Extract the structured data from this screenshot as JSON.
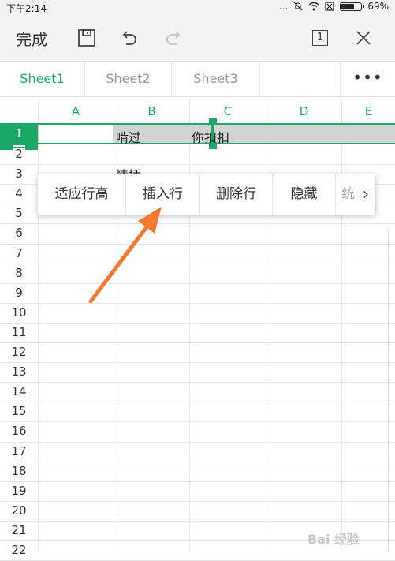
{
  "status": {
    "time": "下午2:14",
    "dots": "...",
    "battery": "69%",
    "battery_level": 0.69
  },
  "toolbar": {
    "done_label": "完成",
    "page_count": "1"
  },
  "tabs": [
    {
      "label": "Sheet1",
      "active": true
    },
    {
      "label": "Sheet2",
      "active": false
    },
    {
      "label": "Sheet3",
      "active": false
    }
  ],
  "more_label": "•••",
  "columns": [
    "A",
    "B",
    "C",
    "D",
    "E"
  ],
  "rows": [
    "1",
    "2",
    "3",
    "4",
    "5",
    "6",
    "7",
    "8",
    "9",
    "10",
    "11",
    "12",
    "13",
    "14",
    "15",
    "16",
    "17",
    "18",
    "19",
    "20",
    "21",
    "22"
  ],
  "cells": {
    "B1": "啃过",
    "C1": "你扣扣",
    "B3": "情插"
  },
  "context_menu": {
    "items": [
      "适应行高",
      "插入行",
      "删除行",
      "隐藏",
      "统"
    ],
    "next": "›"
  },
  "watermark": "Bai 经验",
  "colors": {
    "accent": "#1da86a",
    "arrow": "#f47a30",
    "selection": "#d3d3d3"
  }
}
